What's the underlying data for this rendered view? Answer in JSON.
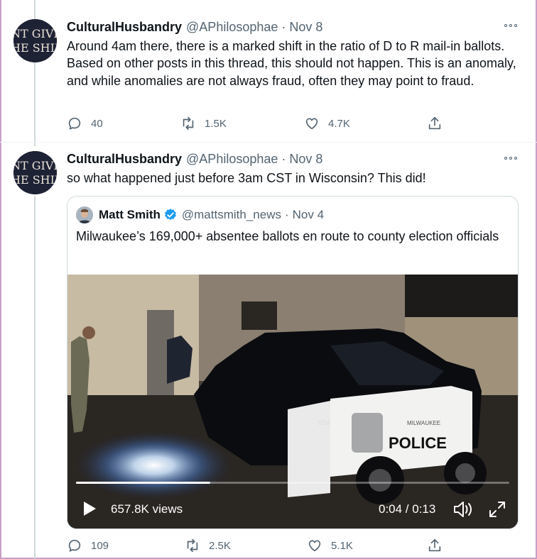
{
  "tweets": [
    {
      "avatar_text": [
        "NT GIVE",
        "HE SHIP"
      ],
      "name": "CulturalHusbandry",
      "handle": "@APhilosophae",
      "separator": "·",
      "date": "Nov 8",
      "text": "Around 4am there, there is a marked shift in the ratio of D to R mail-in ballots. Based on other posts in this thread, this should not happen. This is an anomaly, and while anomalies are not always fraud, often they may point to fraud.",
      "replies": "40",
      "retweets": "1.5K",
      "likes": "4.7K"
    },
    {
      "avatar_text": [
        "NT GIVE",
        "HE SHIP"
      ],
      "name": "CulturalHusbandry",
      "handle": "@APhilosophae",
      "separator": "·",
      "date": "Nov 8",
      "text": "so what happened just before 3am CST in Wisconsin? This did!",
      "replies": "109",
      "retweets": "2.5K",
      "likes": "5.1K"
    }
  ],
  "quote": {
    "name": "Matt Smith",
    "handle": "@mattsmith_news",
    "separator": "·",
    "date": "Nov 4",
    "text": "Milwaukee’s 169,000+ absentee ballots en route to county election officials",
    "video": {
      "views": "657.8K views",
      "time": "0:04 / 0:13",
      "progress": 0.31,
      "door_number": "554",
      "car_text": "POLICE",
      "car_city": "MILWAUKEE"
    }
  },
  "colors": {
    "text": "#0f1419",
    "secondary": "#536471",
    "verified": "#1d9bf0",
    "avatar_bg": "#1e2235"
  }
}
